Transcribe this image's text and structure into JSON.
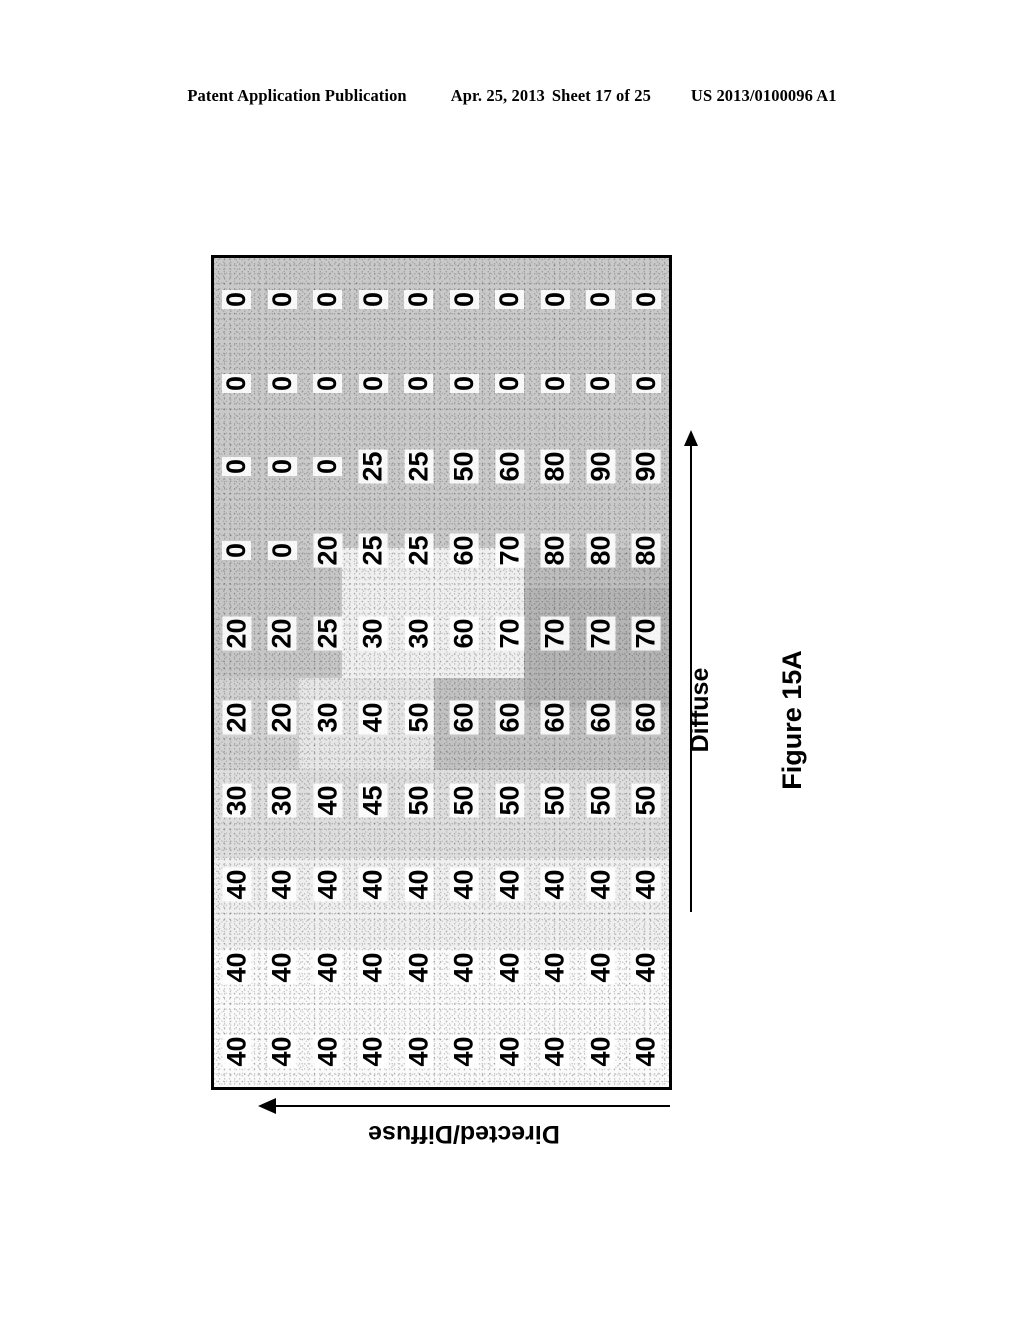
{
  "header": {
    "publication": "Patent Application Publication",
    "date": "Apr. 25, 2013",
    "sheet": "Sheet 17 of 25",
    "patent_number": "US 2013/0100096 A1"
  },
  "figure": {
    "caption": "Figure 15A",
    "vertical_axis_label": "Diffuse",
    "horizontal_axis_label": "Directed/Diffuse",
    "vertical_arrow": "arrow-up-icon",
    "horizontal_arrow": "arrow-left-icon"
  },
  "chart_data": {
    "type": "heatmap",
    "title": "Figure 15A",
    "xlabel": "Directed/Diffuse",
    "ylabel": "Diffuse",
    "grid": true,
    "rows": 10,
    "cols": 10,
    "value_range": [
      0,
      90
    ],
    "note": "Grid of percentage values as printed sideways on the page; each band is one printed row read left to right.",
    "bands": [
      {
        "index": 1,
        "values": [
          0,
          0,
          0,
          0,
          0,
          0,
          0,
          0,
          0,
          0
        ],
        "shade": "mid"
      },
      {
        "index": 2,
        "values": [
          0,
          0,
          0,
          0,
          0,
          0,
          0,
          0,
          0,
          0
        ],
        "shade": "mid"
      },
      {
        "index": 3,
        "values": [
          0,
          0,
          0,
          25,
          25,
          50,
          60,
          80,
          90,
          90
        ],
        "shade": "mid-dark-right"
      },
      {
        "index": 4,
        "values": [
          0,
          0,
          20,
          25,
          25,
          60,
          70,
          80,
          80,
          80
        ],
        "shade": "mixed"
      },
      {
        "index": 5,
        "values": [
          20,
          20,
          25,
          30,
          30,
          60,
          70,
          70,
          70,
          70
        ],
        "shade": "light-left-dark-right"
      },
      {
        "index": 6,
        "values": [
          20,
          20,
          30,
          40,
          50,
          60,
          60,
          60,
          60,
          60
        ],
        "shade": "light"
      },
      {
        "index": 7,
        "values": [
          30,
          30,
          40,
          45,
          50,
          50,
          50,
          50,
          50,
          50
        ],
        "shade": "light"
      },
      {
        "index": 8,
        "values": [
          40,
          40,
          40,
          40,
          40,
          40,
          40,
          40,
          40,
          40
        ],
        "shade": "very-light"
      },
      {
        "index": 9,
        "values": [
          40,
          40,
          40,
          40,
          40,
          40,
          40,
          40,
          40,
          40
        ],
        "shade": "very-light"
      },
      {
        "index": 10,
        "values": [
          40,
          40,
          40,
          40,
          40,
          40,
          40,
          40,
          40,
          40
        ],
        "shade": "very-light"
      }
    ]
  }
}
